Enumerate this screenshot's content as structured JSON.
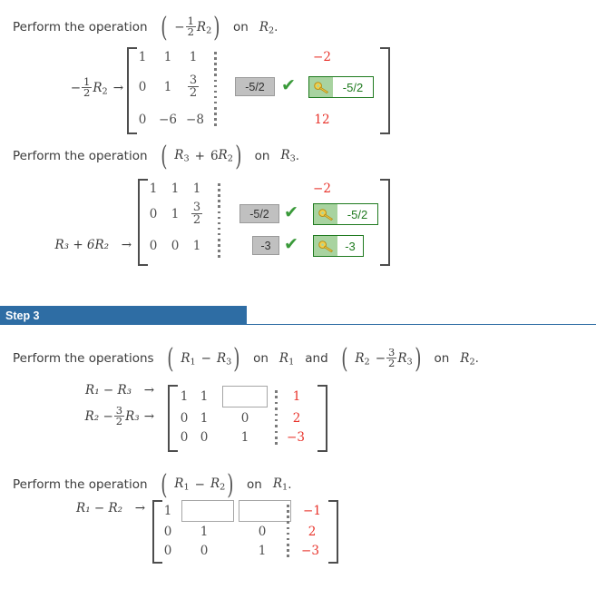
{
  "blocks": {
    "op1": {
      "prompt_lead": "Perform the operation",
      "prompt_mid": "on",
      "prompt_var": "R",
      "prompt_var_sub": "2",
      "prompt_period": ".",
      "op_sign": "−",
      "op_frac_num": "1",
      "op_frac_den": "2",
      "op_var": "R",
      "op_var_sub": "2",
      "rowlabel_sign": "−",
      "rowlabel_num": "1",
      "rowlabel_den": "2",
      "rowlabel_var": "R",
      "rowlabel_var_sub": "2",
      "arrow": "→",
      "matrix": [
        [
          "1",
          "1",
          "1"
        ],
        [
          "0",
          "1",
          ""
        ],
        [
          "0",
          "−6",
          "−8"
        ]
      ],
      "r2c3_num": "3",
      "r2c3_den": "2",
      "aug": [
        "−2",
        "",
        "12"
      ],
      "answer_value": "-5/2",
      "key_value": "-5/2",
      "check_glyph": "✔",
      "key_glyph": "key-icon"
    },
    "op2": {
      "prompt_lead": "Perform the operation",
      "prompt_mid": "on",
      "prompt_var": "R",
      "prompt_var_sub": "3",
      "prompt_period": ".",
      "op_a": "R",
      "op_a_sub": "3",
      "op_plus": "+",
      "op_coef": "6",
      "op_b": "R",
      "op_b_sub": "2",
      "rowlabel": "R₃ + 6R₂",
      "arrow": "→",
      "matrix": [
        [
          "1",
          "1",
          "1"
        ],
        [
          "0",
          "1",
          ""
        ],
        [
          "0",
          "0",
          "1"
        ]
      ],
      "r2c3_num": "3",
      "r2c3_den": "2",
      "aug": [
        "−2",
        "",
        ""
      ],
      "answer_row2": "-5/2",
      "key_row2": "-5/2",
      "answer_row3": "-3",
      "key_row3": "-3",
      "check_glyph": "✔"
    },
    "step3": {
      "header_label": "Step 3",
      "prompt_lead": "Perform the operations",
      "prompt_on1": "on",
      "prompt_var1": "R",
      "prompt_var1_sub": "1",
      "prompt_and": "and",
      "prompt_on2": "on",
      "prompt_var2": "R",
      "prompt_var2_sub": "2",
      "prompt_period": ".",
      "op1_a": "R",
      "op1_a_sub": "1",
      "op1_minus": "−",
      "op1_b": "R",
      "op1_b_sub": "3",
      "op2_a": "R",
      "op2_a_sub": "2",
      "op2_minus": "−",
      "op2_num": "3",
      "op2_den": "2",
      "op2_b": "R",
      "op2_b_sub": "3",
      "rowlabel1": "R₁ − R₃",
      "rowlabel2_pre": "R₂ −",
      "rowlabel2_num": "3",
      "rowlabel2_den": "2",
      "rowlabel2_post": "R₃",
      "arrow": "→",
      "matrix": [
        [
          "1",
          "1",
          ""
        ],
        [
          "0",
          "1",
          "0"
        ],
        [
          "0",
          "0",
          "1"
        ]
      ],
      "aug": [
        "1",
        "2",
        "−3"
      ],
      "blank_input_value": ""
    },
    "op4": {
      "prompt_lead": "Perform the operation",
      "prompt_mid": "on",
      "prompt_var": "R",
      "prompt_var_sub": "1",
      "prompt_period": ".",
      "op_a": "R",
      "op_a_sub": "1",
      "op_minus": "−",
      "op_b": "R",
      "op_b_sub": "2",
      "rowlabel": "R₁ − R₂",
      "arrow": "→",
      "matrix": [
        [
          "1",
          "",
          ""
        ],
        [
          "0",
          "1",
          "0"
        ],
        [
          "0",
          "0",
          "1"
        ]
      ],
      "aug": [
        "−1",
        "2",
        "−3"
      ],
      "blank_input_value": ""
    }
  },
  "colors": {
    "step_header_bg": "#2e6da4",
    "aug_number": "#e8322a",
    "correct_green": "#1f7a1f",
    "key_bg": "#a8d3a0",
    "answer_box_bg": "#c0c0c0"
  }
}
